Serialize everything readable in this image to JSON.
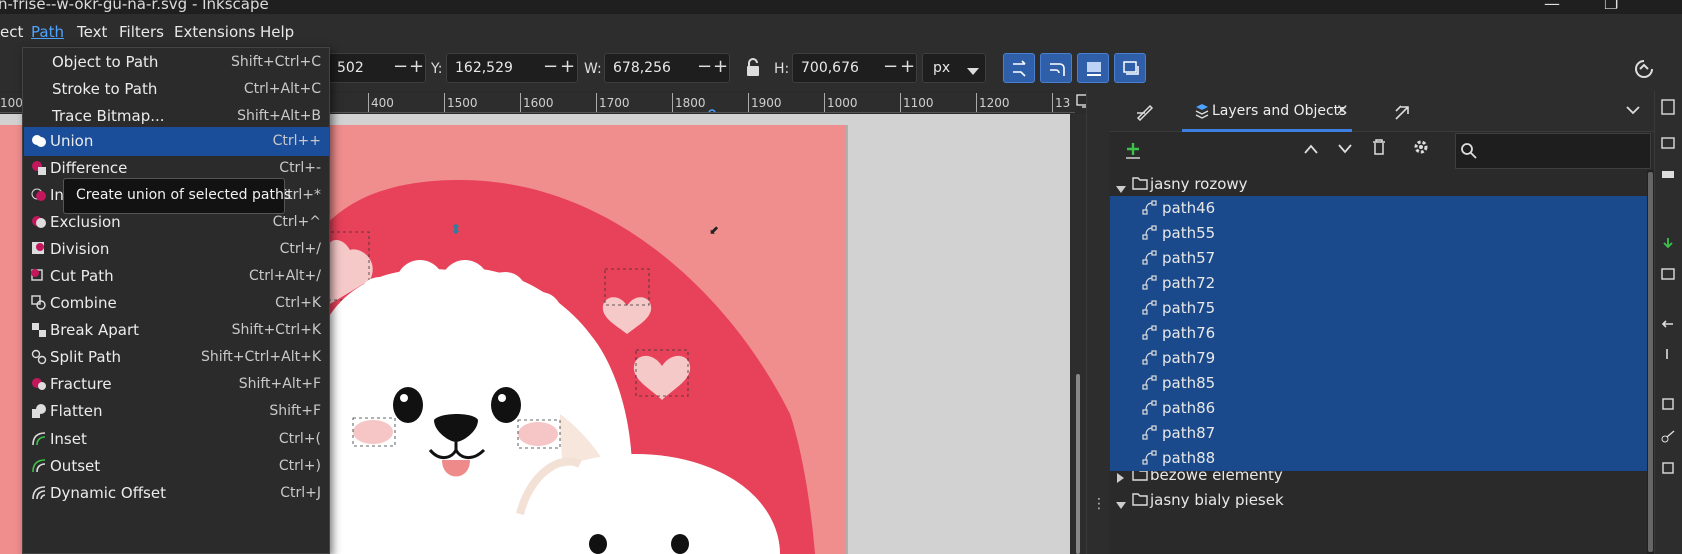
{
  "window": {
    "title": "n-frise--w-okr-gu-na-r.svg - Inkscape"
  },
  "menubar": {
    "items": [
      "ect",
      "Path",
      "Text",
      "Filters",
      "Extensions",
      "Help"
    ],
    "active": "Path"
  },
  "toolbar": {
    "x_value": "502",
    "y_label": "Y:",
    "y_value": "162,529",
    "w_label": "W:",
    "w_value": "678,256",
    "h_label": "H:",
    "h_value": "700,676",
    "unit": "px"
  },
  "ruler": {
    "ticks": [
      "100",
      "400",
      "1500",
      "1600",
      "1700",
      "1800",
      "1900",
      "1000",
      "1100",
      "1200",
      "13"
    ]
  },
  "path_menu": {
    "items": [
      {
        "label": "Object to Path",
        "shortcut": "Shift+Ctrl+C",
        "icon": "none-icon"
      },
      {
        "label": "Stroke to Path",
        "shortcut": "Ctrl+Alt+C",
        "icon": "none-icon"
      },
      {
        "label": "Trace Bitmap...",
        "shortcut": "Shift+Alt+B",
        "icon": "none-icon"
      },
      {
        "label": "Union",
        "shortcut": "Ctrl++",
        "icon": "union-icon"
      },
      {
        "label": "Difference",
        "shortcut": "Ctrl+-",
        "icon": "difference-icon"
      },
      {
        "label": "Intersection",
        "shortcut": "Ctrl+*",
        "icon": "intersection-icon"
      },
      {
        "label": "Exclusion",
        "shortcut": "Ctrl+^",
        "icon": "exclusion-icon"
      },
      {
        "label": "Division",
        "shortcut": "Ctrl+/",
        "icon": "division-icon"
      },
      {
        "label": "Cut Path",
        "shortcut": "Ctrl+Alt+/",
        "icon": "cut-path-icon"
      },
      {
        "label": "Combine",
        "shortcut": "Ctrl+K",
        "icon": "combine-icon"
      },
      {
        "label": "Break Apart",
        "shortcut": "Shift+Ctrl+K",
        "icon": "break-apart-icon"
      },
      {
        "label": "Split Path",
        "shortcut": "Shift+Ctrl+Alt+K",
        "icon": "split-path-icon"
      },
      {
        "label": "Fracture",
        "shortcut": "Shift+Alt+F",
        "icon": "fracture-icon"
      },
      {
        "label": "Flatten",
        "shortcut": "Shift+F",
        "icon": "flatten-icon"
      },
      {
        "label": "Inset",
        "shortcut": "Ctrl+(",
        "icon": "inset-icon"
      },
      {
        "label": "Outset",
        "shortcut": "Ctrl+)",
        "icon": "outset-icon"
      },
      {
        "label": "Dynamic Offset",
        "shortcut": "Ctrl+J",
        "icon": "dynamic-offset-icon"
      }
    ],
    "highlighted": "Union"
  },
  "tooltip": {
    "text": "Create union of selected paths"
  },
  "dock": {
    "tab_label": "Layers and Objects",
    "groups": [
      {
        "name": "jasny rozowy",
        "expanded": true,
        "children": [
          "path46",
          "path55",
          "path57",
          "path72",
          "path75",
          "path76",
          "path79",
          "path85",
          "path86",
          "path87",
          "path88"
        ]
      },
      {
        "name": "bezowe elementy",
        "expanded": false,
        "children": []
      },
      {
        "name": "jasny bialy piesek",
        "expanded": true,
        "children": []
      }
    ]
  },
  "colors": {
    "selection": "#1a4a8c",
    "accent": "#2e5fa8",
    "canvas_bg": "#f08d8d",
    "circle": "#e8415a"
  }
}
